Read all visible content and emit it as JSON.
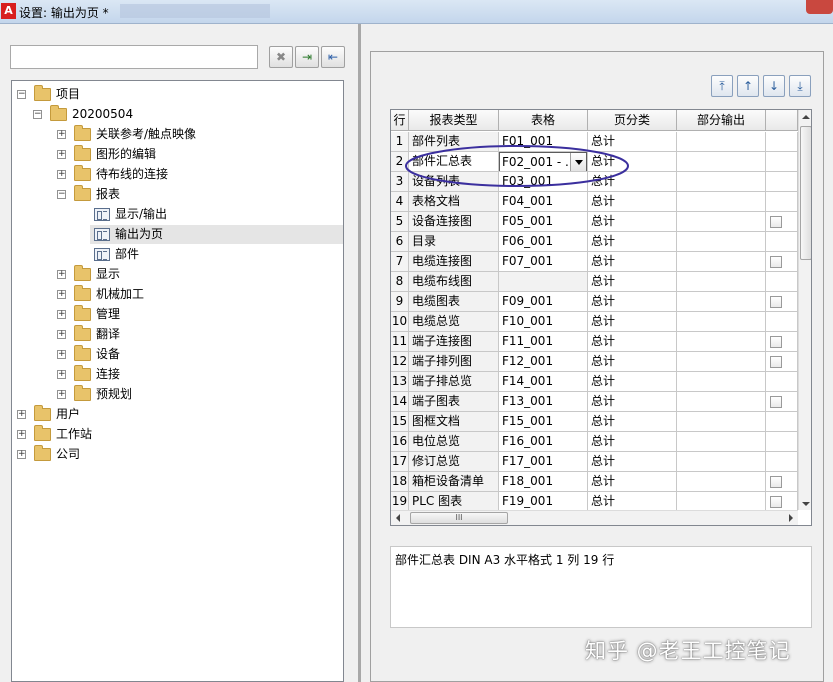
{
  "window": {
    "title": "设置: 输出为页 *"
  },
  "tree": {
    "nodes": [
      {
        "label": "项目",
        "level": 0,
        "expanded": true,
        "icon": "folder"
      },
      {
        "label": "20200504",
        "level": 1,
        "expanded": true,
        "icon": "folder"
      },
      {
        "label": "关联参考/触点映像",
        "level": 2,
        "expanded": false,
        "icon": "folder"
      },
      {
        "label": "图形的编辑",
        "level": 2,
        "expanded": false,
        "icon": "folder"
      },
      {
        "label": "待布线的连接",
        "level": 2,
        "expanded": false,
        "icon": "folder"
      },
      {
        "label": "报表",
        "level": 2,
        "expanded": true,
        "icon": "folder"
      },
      {
        "label": "显示/输出",
        "level": 3,
        "icon": "page"
      },
      {
        "label": "输出为页",
        "level": 3,
        "icon": "page",
        "selected": true
      },
      {
        "label": "部件",
        "level": 3,
        "icon": "page"
      },
      {
        "label": "显示",
        "level": 2,
        "expanded": false,
        "icon": "folder"
      },
      {
        "label": "机械加工",
        "level": 2,
        "expanded": false,
        "icon": "folder"
      },
      {
        "label": "管理",
        "level": 2,
        "expanded": false,
        "icon": "folder"
      },
      {
        "label": "翻译",
        "level": 2,
        "expanded": false,
        "icon": "folder"
      },
      {
        "label": "设备",
        "level": 2,
        "expanded": false,
        "icon": "folder"
      },
      {
        "label": "连接",
        "level": 2,
        "expanded": false,
        "icon": "folder"
      },
      {
        "label": "预规划",
        "level": 2,
        "expanded": false,
        "icon": "folder"
      },
      {
        "label": "用户",
        "level": 0,
        "expanded": false,
        "icon": "folder"
      },
      {
        "label": "工作站",
        "level": 0,
        "expanded": false,
        "icon": "folder"
      },
      {
        "label": "公司",
        "level": 0,
        "expanded": false,
        "icon": "folder"
      }
    ]
  },
  "toolbar": {
    "clear": "✖",
    "import": "⇥",
    "export": "⇤"
  },
  "move_buttons": {
    "top": "⤒",
    "up": "↑",
    "down": "↓",
    "bottom": "⤓"
  },
  "table": {
    "headers": [
      "行",
      "报表类型",
      "表格",
      "页分类",
      "部分输出",
      ""
    ],
    "rows": [
      {
        "n": "1",
        "type": "部件列表",
        "form": "F01_001",
        "cls": "总计",
        "check": false
      },
      {
        "n": "2",
        "type": "部件汇总表",
        "form": "F02_001 - ...",
        "cls": "总计",
        "check": false,
        "editing": true
      },
      {
        "n": "3",
        "type": "设备列表",
        "form": "F03_001",
        "cls": "总计",
        "check": false
      },
      {
        "n": "4",
        "type": "表格文档",
        "form": "F04_001",
        "cls": "总计",
        "check": false
      },
      {
        "n": "5",
        "type": "设备连接图",
        "form": "F05_001",
        "cls": "总计",
        "check": true
      },
      {
        "n": "6",
        "type": "目录",
        "form": "F06_001",
        "cls": "总计",
        "check": false
      },
      {
        "n": "7",
        "type": "电缆连接图",
        "form": "F07_001",
        "cls": "总计",
        "check": true
      },
      {
        "n": "8",
        "type": "电缆布线图",
        "form": "",
        "cls": "总计",
        "check": false
      },
      {
        "n": "9",
        "type": "电缆图表",
        "form": "F09_001",
        "cls": "总计",
        "check": true
      },
      {
        "n": "10",
        "type": "电缆总览",
        "form": "F10_001",
        "cls": "总计",
        "check": false
      },
      {
        "n": "11",
        "type": "端子连接图",
        "form": "F11_001",
        "cls": "总计",
        "check": true
      },
      {
        "n": "12",
        "type": "端子排列图",
        "form": "F12_001",
        "cls": "总计",
        "check": true
      },
      {
        "n": "13",
        "type": "端子排总览",
        "form": "F14_001",
        "cls": "总计",
        "check": false
      },
      {
        "n": "14",
        "type": "端子图表",
        "form": "F13_001",
        "cls": "总计",
        "check": true
      },
      {
        "n": "15",
        "type": "图框文档",
        "form": "F15_001",
        "cls": "总计",
        "check": false
      },
      {
        "n": "16",
        "type": "电位总览",
        "form": "F16_001",
        "cls": "总计",
        "check": false
      },
      {
        "n": "17",
        "type": "修订总览",
        "form": "F17_001",
        "cls": "总计",
        "check": false
      },
      {
        "n": "18",
        "type": "箱柜设备清单",
        "form": "F18_001",
        "cls": "总计",
        "check": true
      },
      {
        "n": "19",
        "type": "PLC 图表",
        "form": "F19_001",
        "cls": "总计",
        "check": true
      }
    ],
    "hscroll_thumb": "III"
  },
  "description": "部件汇总表 DIN A3 水平格式 1 列 19 行",
  "watermark": "知乎 @老王工控笔记",
  "colors": {
    "annotation": "#3b2f9e",
    "title_bar": "#c9d9ee"
  }
}
